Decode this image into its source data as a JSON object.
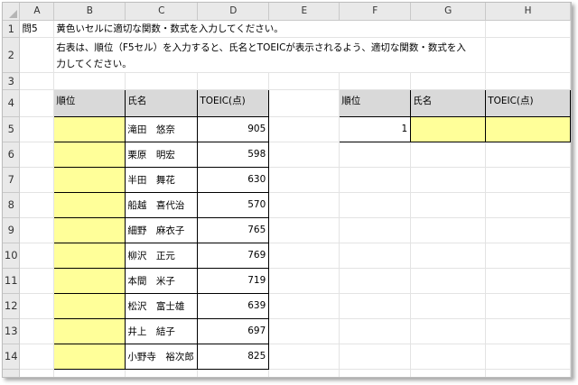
{
  "columns": [
    "A",
    "B",
    "C",
    "D",
    "E",
    "F",
    "G",
    "H"
  ],
  "rows": [
    "1",
    "2",
    "3",
    "4",
    "5",
    "6",
    "7",
    "8",
    "9",
    "10",
    "11",
    "12",
    "13",
    "14"
  ],
  "question": {
    "label": "問5",
    "line1": "黄色いセルに適切な関数・数式を入力してください。",
    "line2": "右表は、順位（F5セル）を入力すると、氏名とTOEICが表示されるよう、適切な関数・数式を入",
    "line3": "力してください。"
  },
  "main_table": {
    "headers": [
      "順位",
      "氏名",
      "TOEIC(点)"
    ],
    "rows": [
      {
        "name": "滝田　悠奈",
        "score": "905"
      },
      {
        "name": "栗原　明宏",
        "score": "598"
      },
      {
        "name": "半田　舞花",
        "score": "630"
      },
      {
        "name": "船越　喜代治",
        "score": "570"
      },
      {
        "name": "細野　麻衣子",
        "score": "765"
      },
      {
        "name": "柳沢　正元",
        "score": "769"
      },
      {
        "name": "本間　米子",
        "score": "719"
      },
      {
        "name": "松沢　富士雄",
        "score": "639"
      },
      {
        "name": "井上　結子",
        "score": "697"
      },
      {
        "name": "小野寺　裕次郎",
        "score": "825"
      }
    ]
  },
  "lookup_table": {
    "headers": [
      "順位",
      "氏名",
      "TOEIC(点)"
    ],
    "rank_value": "1"
  },
  "colors": {
    "input_cell": "#ffff99",
    "header_cell": "#d9d9d9",
    "grid_header": "#e9e9e9"
  }
}
